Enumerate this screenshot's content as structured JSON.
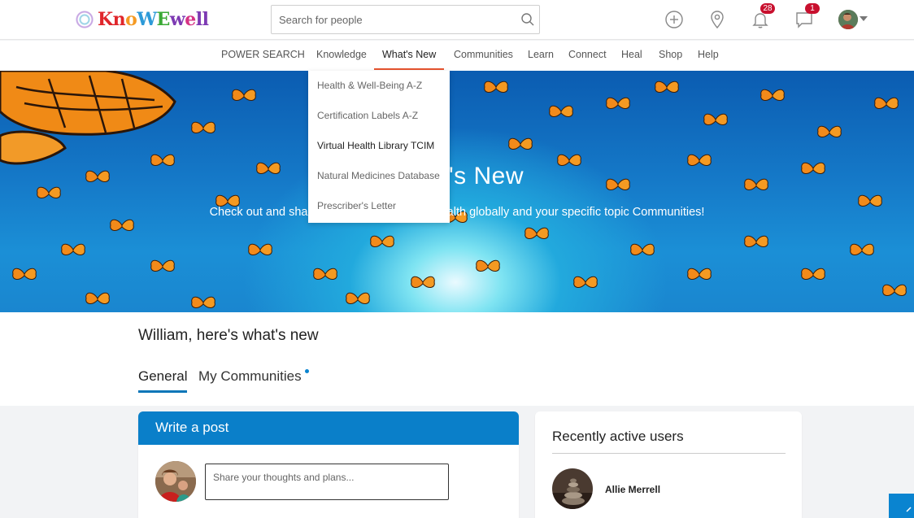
{
  "header": {
    "logo_text": "KnoWEwell",
    "search_placeholder": "Search for people",
    "notifications_count": "28",
    "messages_count": "1"
  },
  "nav": {
    "items": [
      "POWER SEARCH",
      "Knowledge",
      "What's New",
      "Communities",
      "Learn",
      "Connect",
      "Heal",
      "Shop",
      "Help"
    ],
    "active": "What's New",
    "accent_color": "#e8542f"
  },
  "dropdown": {
    "items": [
      "Health & Well-Being A-Z",
      "Certification Labels A-Z",
      "Virtual Health Library TCIM",
      "Natural Medicines Database",
      "Prescriber's Letter"
    ],
    "highlighted": "Virtual Health Library TCIM"
  },
  "hero": {
    "title": "What's New",
    "subtitle": "Check out and share what's new in Whole Health globally and your specific topic Communities!"
  },
  "main": {
    "greeting": "William, here's what's new",
    "tabs": [
      "General",
      "My Communities"
    ],
    "active_tab": "General",
    "brand_color": "#0a7fc9"
  },
  "post_card": {
    "title": "Write a post",
    "input_placeholder": "Share your thoughts and plans..."
  },
  "users_card": {
    "title": "Recently active users",
    "users": [
      "Allie Merrell"
    ]
  }
}
